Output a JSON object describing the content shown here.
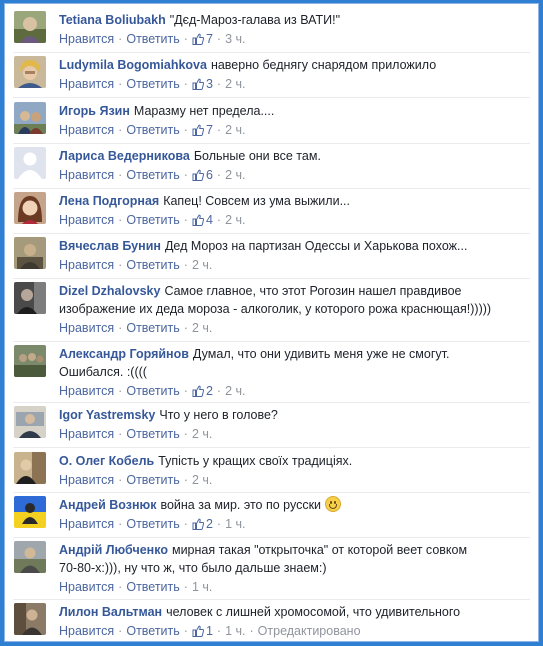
{
  "labels": {
    "like": "Нравится",
    "reply": "Ответить",
    "edited": "Отредактировано"
  },
  "comments": [
    {
      "author": "Tetiana Boliubakh",
      "text": "\"Дєд-Мароз-галава из ВАТИ!\"",
      "likes": "7",
      "time": "3 ч."
    },
    {
      "author": "Ludymila Bogomiahkova",
      "text": "наверно беднягу снарядом приложило",
      "likes": "3",
      "time": "2 ч."
    },
    {
      "author": "Игорь Язин",
      "text": "Маразму нет предела....",
      "likes": "7",
      "time": "2 ч."
    },
    {
      "author": "Лариса Ведерникова",
      "text": "Больные они все там.",
      "likes": "6",
      "time": "2 ч."
    },
    {
      "author": "Лена Подгорная",
      "text": "Капец! Совсем из ума выжили...",
      "likes": "4",
      "time": "2 ч."
    },
    {
      "author": "Вячеслав Бунин",
      "text": "Дед Мороз на партизан Одессы и Харькова похож...",
      "likes": "",
      "time": "2 ч."
    },
    {
      "author": "Dizel Dzhalovsky",
      "text": "Самое главное, что этот Рогозин нашел правдивое",
      "text2": "изображение их деда мороза - алкоголик, у которого рожа краснющая!)))))",
      "likes": "",
      "time": "2 ч."
    },
    {
      "author": "Александр Горяйнов",
      "text": "Думал, что они удивить меня уже не смогут.",
      "text2": "Ошибался. :((((",
      "likes": "2",
      "time": "2 ч."
    },
    {
      "author": "Igor Yastremsky",
      "text": "Что у него в голове?",
      "likes": "",
      "time": "2 ч."
    },
    {
      "author": "О. Олег Кобель",
      "text": "Тупість у кращих своїх традиціях.",
      "likes": "",
      "time": "2 ч."
    },
    {
      "author": "Андрей Вознюк",
      "text": "война за мир. это по русски",
      "likes": "2",
      "time": "1 ч."
    },
    {
      "author": "Андрій Любченко",
      "text": "мирная такая \"открыточка\" от которой веет совком",
      "text2": "70-80-х:))), ну что ж, что было дальше знаем:)",
      "likes": "",
      "time": "1 ч."
    },
    {
      "author": "Лилон Вальтман",
      "text": "человек с лишней хромосомой, что удивительного",
      "likes": "1",
      "time": "1 ч."
    }
  ]
}
